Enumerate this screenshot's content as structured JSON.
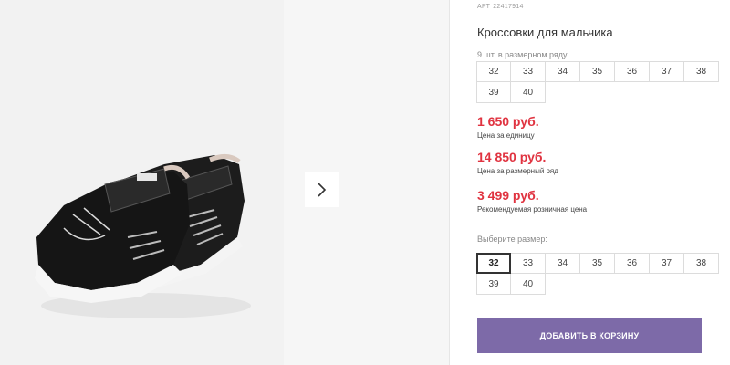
{
  "product": {
    "article_prefix": "АРТ",
    "article_number": "22417914",
    "title": "Кроссовки для мальчика",
    "size_row_caption": "9 шт. в размерном ряду",
    "size_row": [
      "32",
      "33",
      "34",
      "35",
      "36",
      "37",
      "38",
      "39",
      "40"
    ]
  },
  "prices": {
    "unit_price": "1 650 руб.",
    "unit_label": "Цена за единицу",
    "row_price": "14 850 руб.",
    "row_label": "Цена за размерный ряд",
    "retail_price": "3 499 руб.",
    "retail_label": "Рекомендуемая розничная цена"
  },
  "size_select": {
    "caption": "Выберите размер:",
    "options": [
      "32",
      "33",
      "34",
      "35",
      "36",
      "37",
      "38",
      "39",
      "40"
    ],
    "selected": "32"
  },
  "actions": {
    "add_to_cart": "ДОБАВИТЬ В КОРЗИНУ",
    "next_icon": "chevron-right-icon"
  },
  "colors": {
    "price": "#e03340",
    "button": "#7d6aa8"
  }
}
